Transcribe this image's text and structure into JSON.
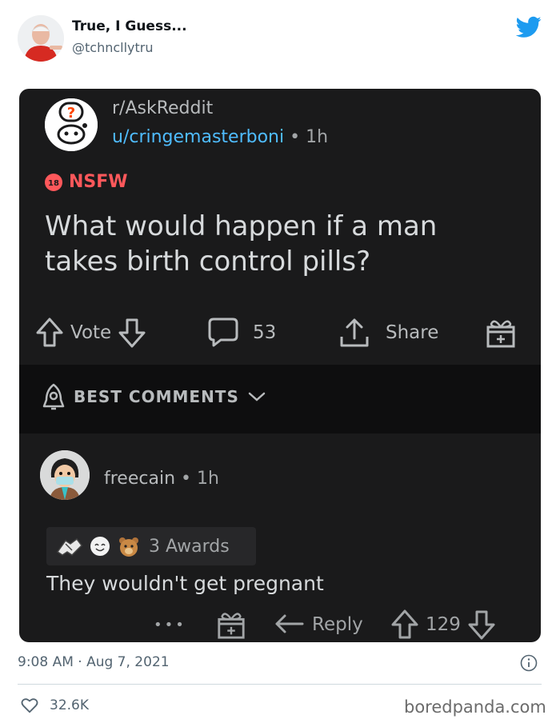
{
  "tweet": {
    "author_name": "True, I Guess...",
    "author_handle": "@tchncllytru",
    "timestamp": "9:08 AM · Aug 7, 2021",
    "likes": "32.6K",
    "watermark": "boredpanda.com"
  },
  "post": {
    "subreddit": "r/AskReddit",
    "username": "u/cringemasterboni",
    "separator": " • ",
    "time": "1h",
    "nsfw_label": "NSFW",
    "nsfw_badge_text": "18",
    "title": "What would happen if a man takes birth control pills?",
    "vote_label": "Vote",
    "comment_count": "53",
    "share_label": "Share"
  },
  "comments_header": {
    "label": "BEST COMMENTS"
  },
  "comment": {
    "username": "freecain",
    "separator": " • ",
    "time": "1h",
    "awards_label": "3 Awards",
    "text": "They wouldn't get pregnant",
    "more_label": "•••",
    "reply_label": "Reply",
    "score": "129"
  },
  "colors": {
    "card_bg": "#1a1a1b",
    "username_link": "#4fbcff",
    "nsfw": "#ff585b",
    "twitter_blue": "#1d9bf0"
  }
}
